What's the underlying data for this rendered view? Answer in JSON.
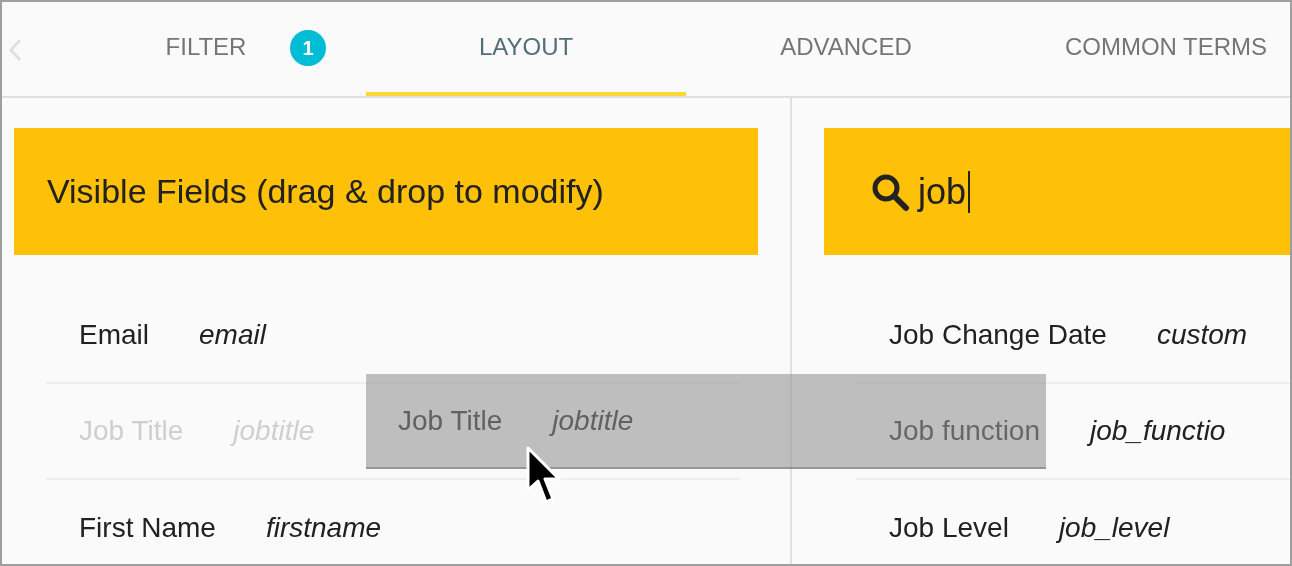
{
  "tabs": [
    {
      "label": "FILTER",
      "selected": false,
      "badge": "1"
    },
    {
      "label": "LAYOUT",
      "selected": true
    },
    {
      "label": "ADVANCED",
      "selected": false
    },
    {
      "label": "COMMON TERMS",
      "selected": false
    }
  ],
  "visible_fields": {
    "title": "Visible Fields (drag & drop to modify)",
    "rows": [
      {
        "kind": "field",
        "label": "Email",
        "name": "email"
      },
      {
        "kind": "drop_placeholder",
        "label": "Job Title",
        "name": "jobtitle"
      },
      {
        "kind": "field",
        "label": "First Name",
        "name": "firstname"
      }
    ]
  },
  "available_fields": {
    "search": {
      "value": "job"
    },
    "rows": [
      {
        "label": "Job Change Date",
        "name": "custom"
      },
      {
        "label": "Job function",
        "name": "job_functio"
      },
      {
        "label": "Job Level",
        "name": "job_level"
      }
    ]
  },
  "drag_item": {
    "label": "Job Title",
    "name": "jobtitle"
  }
}
